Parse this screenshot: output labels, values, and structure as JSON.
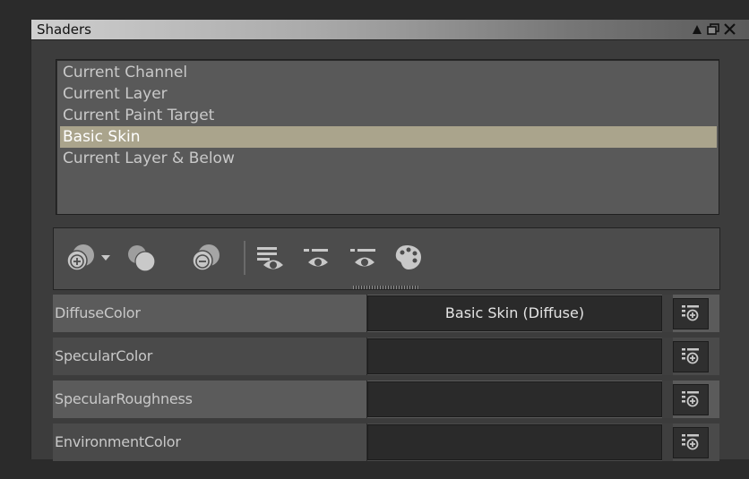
{
  "window": {
    "title": "Shaders",
    "buttons": {
      "collapse_icon": "triangle-up-icon",
      "float_icon": "float-window-icon",
      "close_icon": "close-icon"
    }
  },
  "stack_list": {
    "items": [
      {
        "label": "Current Channel",
        "selected": false
      },
      {
        "label": "Current Layer",
        "selected": false
      },
      {
        "label": "Current Paint Target",
        "selected": false
      },
      {
        "label": "Basic Skin",
        "selected": true
      },
      {
        "label": "Current Layer & Below",
        "selected": false
      }
    ]
  },
  "toolbar": {
    "tools": [
      "add-shader-icon",
      "dropdown-arrow-icon",
      "duplicate-shader-icon",
      "remove-shader-icon",
      "view-all-channels-icon",
      "view-channel-icon",
      "view-selected-icon",
      "paint-palette-icon"
    ]
  },
  "properties": {
    "rows": [
      {
        "label": "DiffuseColor",
        "value": "Basic Skin (Diffuse)"
      },
      {
        "label": "SpecularColor",
        "value": ""
      },
      {
        "label": "SpecularRoughness",
        "value": ""
      },
      {
        "label": "EnvironmentColor",
        "value": ""
      }
    ]
  },
  "colors": {
    "selection": "#aaa48c",
    "panel_bg": "#3c3c3c",
    "list_bg": "#595959",
    "value_bg": "#2a2a2a",
    "icon": "#c8c8c8"
  }
}
